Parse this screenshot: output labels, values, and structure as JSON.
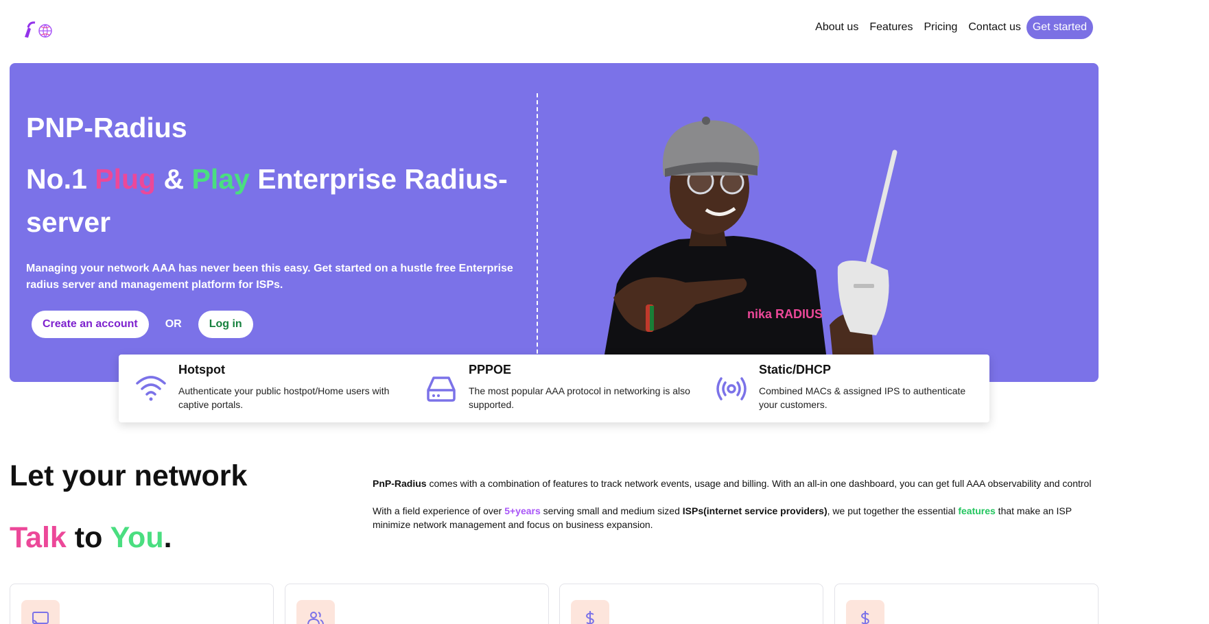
{
  "header": {
    "logo_icon": "plug-globe-logo-icon",
    "nav": [
      {
        "label": "About us"
      },
      {
        "label": "Features"
      },
      {
        "label": "Pricing"
      },
      {
        "label": "Contact us"
      }
    ],
    "cta_label": "Get started"
  },
  "hero": {
    "brand": "PNP-Radius",
    "headline_prefix": "No.1 ",
    "headline_plug": "Plug",
    "headline_amp": " & ",
    "headline_play": "Play",
    "headline_suffix": " Enterprise Radius-server",
    "subtitle": "Managing your network AAA has never been this easy. Get started on a hustle free Enterprise radius server and management platform for ISPs.",
    "create_label": "Create an account",
    "or_label": "OR",
    "login_label": "Log in",
    "image_shirt_text": "nika RADIUS"
  },
  "features": [
    {
      "icon": "wifi-icon",
      "title": "Hotspot",
      "desc": "Authenticate your public hostpot/Home users with captive portals."
    },
    {
      "icon": "hard-drive-icon",
      "title": "PPPOE",
      "desc": "The most popular AAA protocol in networking is also supported."
    },
    {
      "icon": "broadcast-icon",
      "title": "Static/DHCP",
      "desc": "Combined MACs & assigned IPS to authenticate your customers."
    }
  ],
  "section": {
    "heading_line1": "Let your network",
    "talk": "Talk",
    "to": " to ",
    "you": "You",
    "period": ".",
    "para1_brand": "PnP-Radius",
    "para1_rest": " comes with a combination of features to track network events, usage and billing. With an all-in one dashboard, you can get full AAA observability and control",
    "para2_a": "With a field experience of over ",
    "para2_years": "5+years",
    "para2_b": " serving small and medium sized ",
    "para2_isps": "ISPs(internet service providers)",
    "para2_c": ", we put together the essential ",
    "para2_features": "features",
    "para2_d": " that make an ISP minimize network management and focus on business expansion."
  },
  "cards": [
    {
      "icon": "cast-icon"
    },
    {
      "icon": "users-icon"
    },
    {
      "icon": "dollar-icon"
    },
    {
      "icon": "dollar-icon"
    }
  ],
  "colors": {
    "accent": "#7b72e8",
    "pink": "#ec4899",
    "green": "#4ade80",
    "purple": "#a855f7"
  }
}
